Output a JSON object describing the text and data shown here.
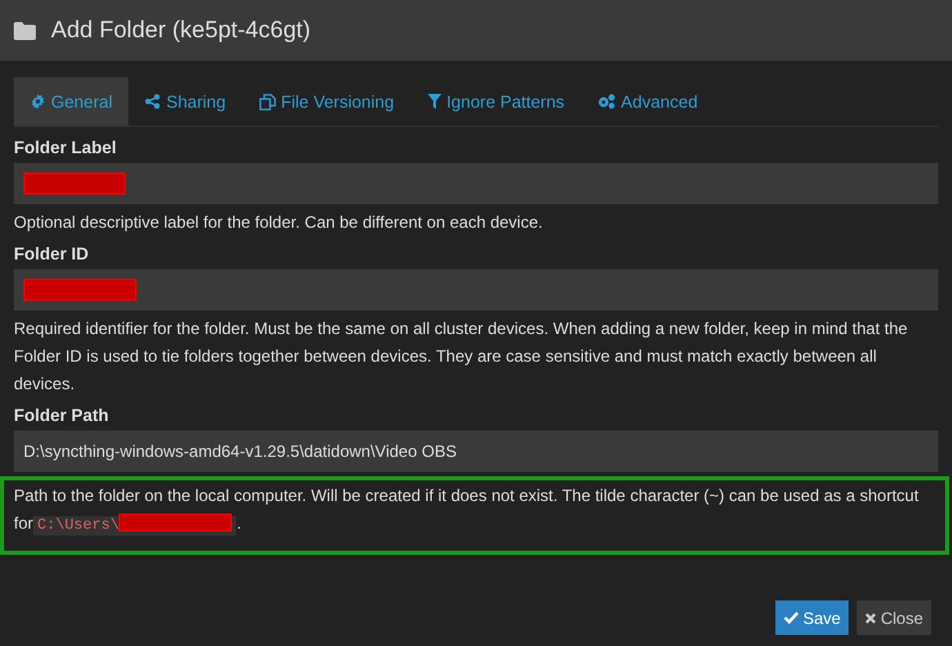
{
  "window": {
    "title": "Add Folder (ke5pt-4c6gt)"
  },
  "tabs": [
    {
      "label": "General",
      "kind": "gear",
      "selected": true
    },
    {
      "label": "Sharing",
      "kind": "share",
      "selected": false
    },
    {
      "label": "File Versioning",
      "kind": "copy",
      "selected": false
    },
    {
      "label": "Ignore Patterns",
      "kind": "filter",
      "selected": false
    },
    {
      "label": "Advanced",
      "kind": "gears",
      "selected": false
    }
  ],
  "fields": [
    {
      "label": "Folder Label",
      "redacted": true,
      "help": "Optional descriptive label for the folder. Can be different on each device.",
      "highlighted": false
    },
    {
      "label": "Folder ID",
      "redacted": true,
      "help": "Required identifier for the folder. Must be the same on all cluster devices. When adding a new folder, keep in mind that the Folder ID is used to tie folders together between devices. They are case sensitive and must match exactly between all devices.",
      "highlighted": false
    },
    {
      "label": "Folder Path",
      "value": "D:\\syncthing-windows-amd64-v1.29.5\\datidown\\Video OBS",
      "help": "Path to the folder on the local computer. Will be created if it does not exist. The tilde character (~) can be used as a shortcut for",
      "help_code": "C:\\Users\\",
      "help_code_redacted": true,
      "help_end": ".",
      "highlighted": true
    }
  ],
  "buttons": [
    {
      "label": "Save",
      "kind": "primary"
    },
    {
      "label": "Close",
      "kind": "default"
    }
  ]
}
